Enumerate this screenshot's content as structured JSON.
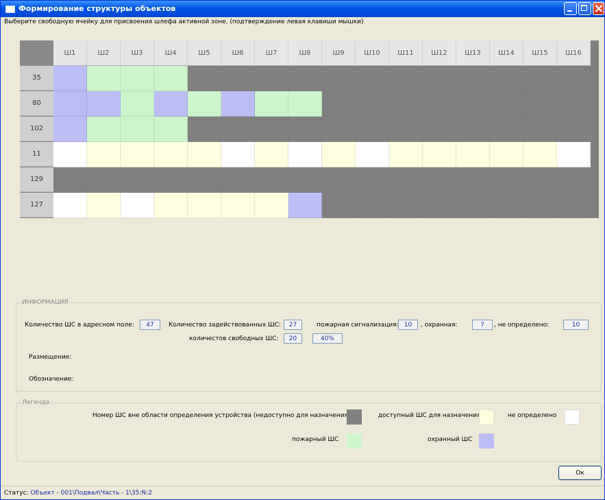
{
  "window": {
    "title": "Формирование структуры объектов"
  },
  "hint": "Выберите свободную ячейку для присвоения шлефа активной зоне. (подтверждение левая клавиши мышки)",
  "grid": {
    "columns": [
      "Ш1",
      "Ш2",
      "Ш3",
      "Ш4",
      "Ш5",
      "Ш6",
      "Ш7",
      "Ш8",
      "Ш9",
      "Ш10",
      "Ш11",
      "Ш12",
      "Ш13",
      "Ш14",
      "Ш15",
      "Ш16"
    ],
    "rows": [
      {
        "label": "35",
        "cells": [
          "b",
          "n",
          "n",
          "n",
          "g",
          "g",
          "g",
          "g",
          "g",
          "g",
          "g",
          "g",
          "g",
          "g",
          "g",
          "g"
        ]
      },
      {
        "label": "80",
        "cells": [
          "b",
          "b",
          "n",
          "b",
          "n",
          "b",
          "n",
          "n",
          "g",
          "g",
          "g",
          "g",
          "g",
          "g",
          "g",
          "g"
        ]
      },
      {
        "label": "102",
        "cells": [
          "b",
          "n",
          "n",
          "n",
          "g",
          "g",
          "g",
          "g",
          "g",
          "g",
          "g",
          "g",
          "g",
          "g",
          "g",
          "g"
        ]
      },
      {
        "label": "11",
        "cells": [
          "w",
          "y",
          "y",
          "y",
          "y",
          "w",
          "y",
          "w",
          "y",
          "w",
          "y",
          "y",
          "y",
          "y",
          "y",
          "w"
        ]
      },
      {
        "label": "129",
        "cells": [
          "g",
          "g",
          "g",
          "g",
          "g",
          "g",
          "g",
          "g",
          "g",
          "g",
          "g",
          "g",
          "g",
          "g",
          "g",
          "g"
        ]
      },
      {
        "label": "127",
        "cells": [
          "w",
          "y",
          "w",
          "y",
          "y",
          "y",
          "y",
          "b",
          "g",
          "g",
          "g",
          "g",
          "g",
          "g",
          "g",
          "g"
        ]
      }
    ],
    "colors": {
      "g": "#808080",
      "y": "#ffffe0",
      "w": "#ffffff",
      "n": "#ccf5cc",
      "b": "#bdbdf5"
    }
  },
  "info": {
    "title": "ИНФОРМАЦИЯ",
    "address_label": "Количество ШС в адресном поле:",
    "address_value": "47",
    "used_label": "Количество задействованных ШС:",
    "used_value": "27",
    "fire_label": "пожарная сигнализация:",
    "fire_value": "10",
    "security_label": ", охранная:",
    "security_value": "7",
    "undefined_label": ", не определено:",
    "undefined_value": "10",
    "free_label": "количестов свободных ШС:",
    "free_value": "20",
    "free_percent": "40%",
    "placement_label": "Размещение:",
    "designation_label": "Обозначение:"
  },
  "legend": {
    "title": "Легенда",
    "out_of_range": "Номер ШС вне области определения устройства (недоступно для назначения)",
    "available": "доступный ШС для назначения",
    "undefined": "не определено",
    "fire": "пожарный ШС",
    "security": "охранный ШС"
  },
  "ok_label": "Ок",
  "status": {
    "label": "Статус:",
    "value": "Объект - 001\\Подвал\\Часть - 1\\35:N:2"
  }
}
